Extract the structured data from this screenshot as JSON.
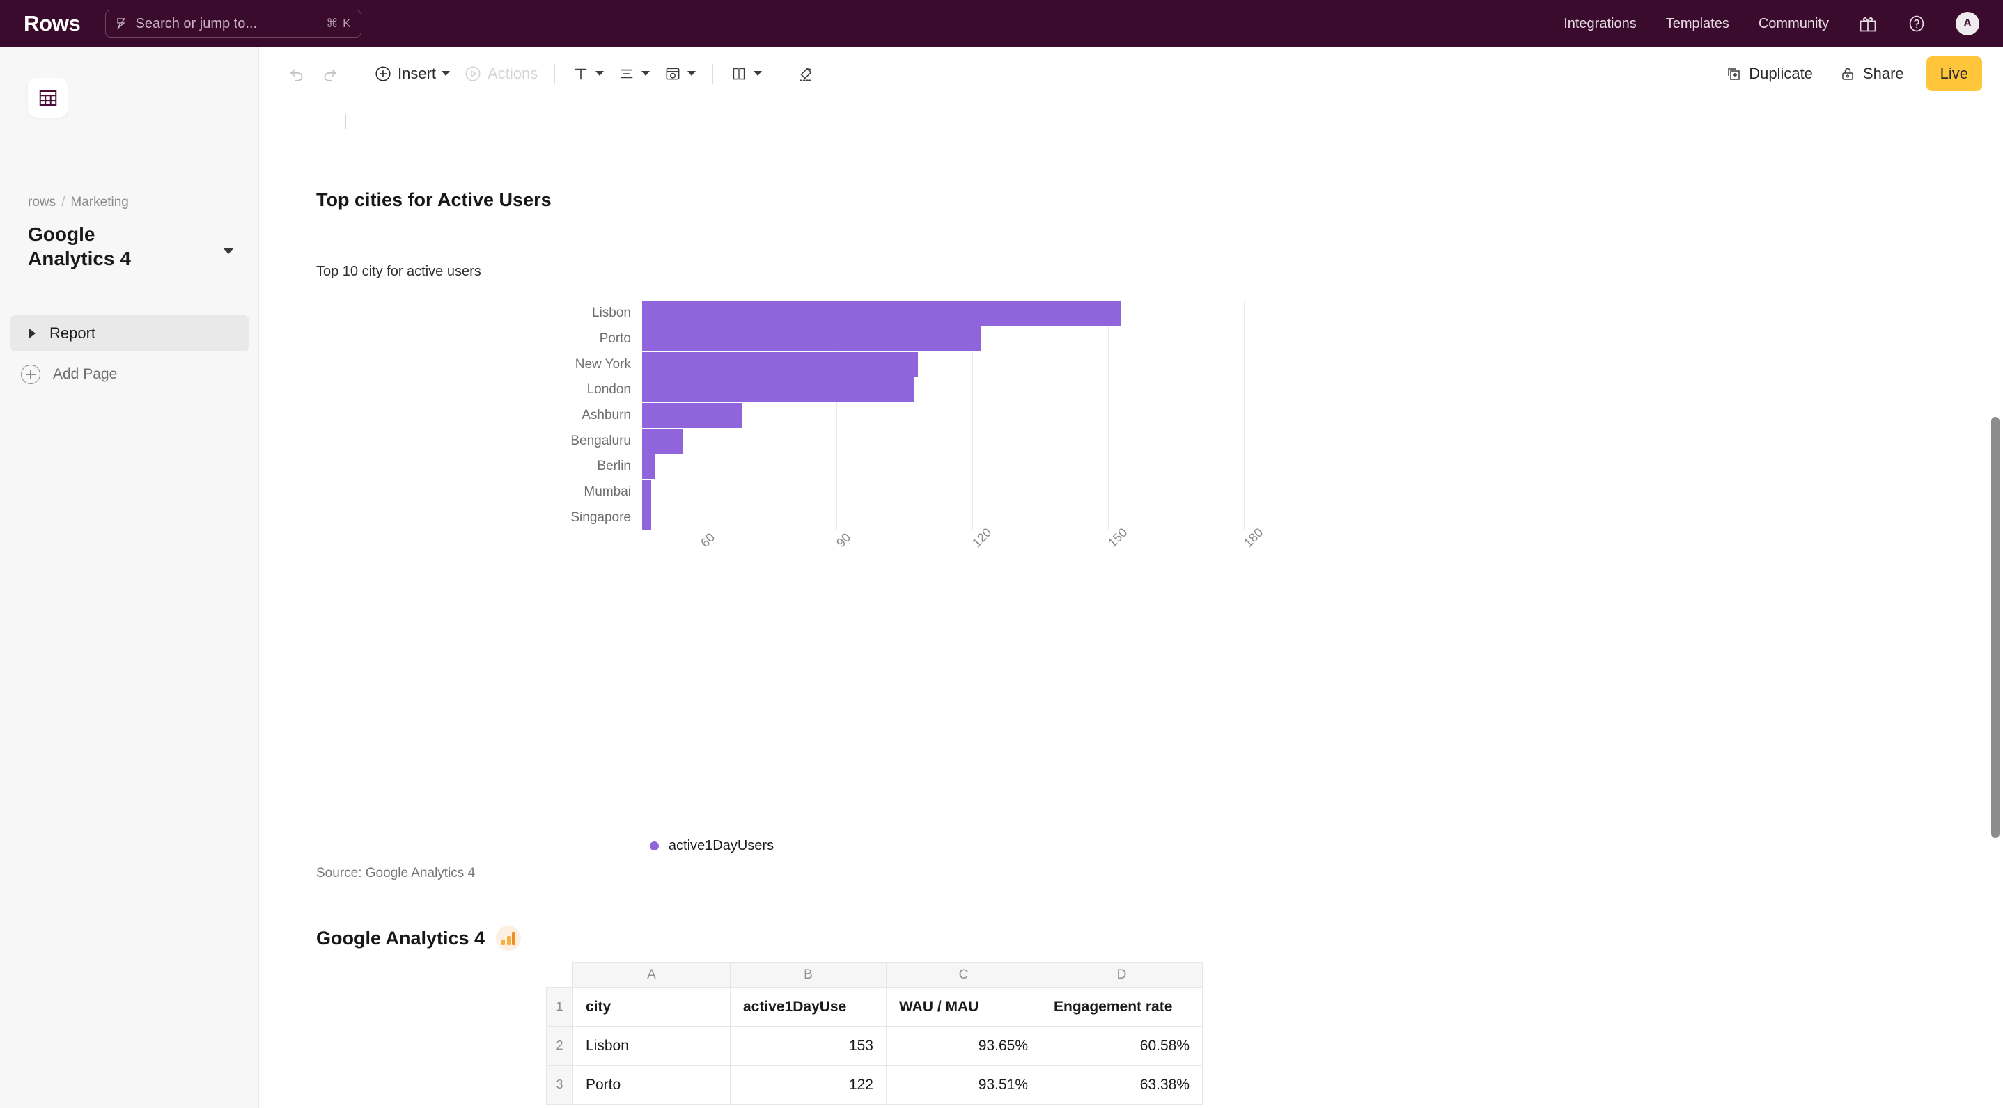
{
  "topbar": {
    "brand": "Rows",
    "search": {
      "placeholder": "Search or jump to...",
      "shortcut": "⌘ K",
      "icon": "bolt-icon"
    },
    "nav": [
      {
        "label": "Integrations"
      },
      {
        "label": "Templates"
      },
      {
        "label": "Community"
      }
    ],
    "gift_icon": "gift-icon",
    "help_icon": "help-circle-icon",
    "avatar": "A"
  },
  "sidebar": {
    "doc_icon": "spreadsheet-icon",
    "breadcrumb": {
      "workspace": "rows",
      "separator": "/",
      "folder": "Marketing"
    },
    "title": "Google Analytics 4",
    "pages": [
      {
        "label": "Report",
        "selected": true
      }
    ],
    "add_page": "Add Page"
  },
  "toolbar": {
    "undo": "undo-icon",
    "redo": "redo-icon",
    "insert": "Insert",
    "actions": "Actions",
    "text_format": "text-format-icon",
    "align": "align-icon",
    "theme": "theme-palette-icon",
    "layout": "layout-icon",
    "clear_format": "clear-formatting-icon",
    "duplicate": "Duplicate",
    "share": "Share",
    "live": "Live"
  },
  "chart_data": {
    "type": "bar",
    "orientation": "horizontal",
    "title": "Top cities for Active Users",
    "subtitle": "Top 10 city for active users",
    "source": "Source: Google Analytics 4",
    "xlabel": "",
    "ylabel": "",
    "grid": true,
    "legend_position": "bottom",
    "series": [
      {
        "name": "active1DayUsers",
        "color": "#9064DB"
      }
    ],
    "xlim": [
      47,
      191
    ],
    "xticks": [
      60,
      90,
      120,
      150,
      180
    ],
    "categories": [
      "Lisbon",
      "Porto",
      "New York",
      "London",
      "Ashburn",
      "Bengaluru",
      "Berlin",
      "Mumbai",
      "Singapore"
    ],
    "values": [
      153,
      122,
      108,
      107,
      69,
      56,
      50,
      49,
      49
    ]
  },
  "table_block": {
    "title": "Google Analytics 4",
    "badge_icon": "google-analytics-icon",
    "column_headers": [
      "A",
      "B",
      "C",
      "D"
    ],
    "rows": [
      {
        "n": "1",
        "cells": [
          "city",
          "active1DayUse",
          "WAU / MAU",
          "Engagement rate"
        ],
        "header": true
      },
      {
        "n": "2",
        "cells": [
          "Lisbon",
          "153",
          "93.65%",
          "60.58%"
        ],
        "header": false
      },
      {
        "n": "3",
        "cells": [
          "Porto",
          "122",
          "93.51%",
          "63.38%"
        ],
        "header": false
      }
    ]
  }
}
